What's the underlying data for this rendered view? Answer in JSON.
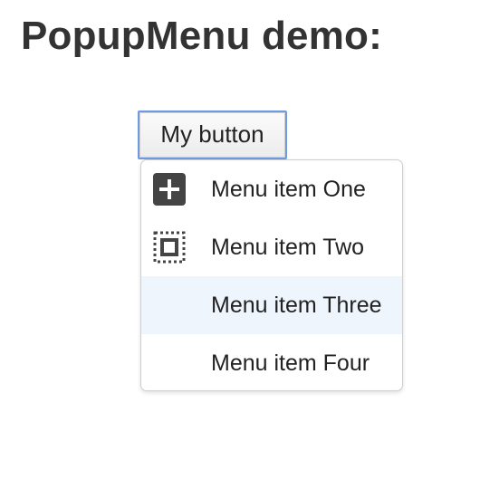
{
  "page": {
    "title": "PopupMenu demo:"
  },
  "trigger": {
    "label": "My button"
  },
  "menu": {
    "items": [
      {
        "label": "Menu item One",
        "icon": "plus-square-icon"
      },
      {
        "label": "Menu item Two",
        "icon": "dotted-square-icon"
      },
      {
        "label": "Menu item Three",
        "icon": "",
        "highlighted": true
      },
      {
        "label": "Menu item Four",
        "icon": ""
      }
    ]
  },
  "colors": {
    "highlight": "#eef5fd",
    "button_focus_border": "#6e9be0",
    "icon_dark": "#444444"
  }
}
